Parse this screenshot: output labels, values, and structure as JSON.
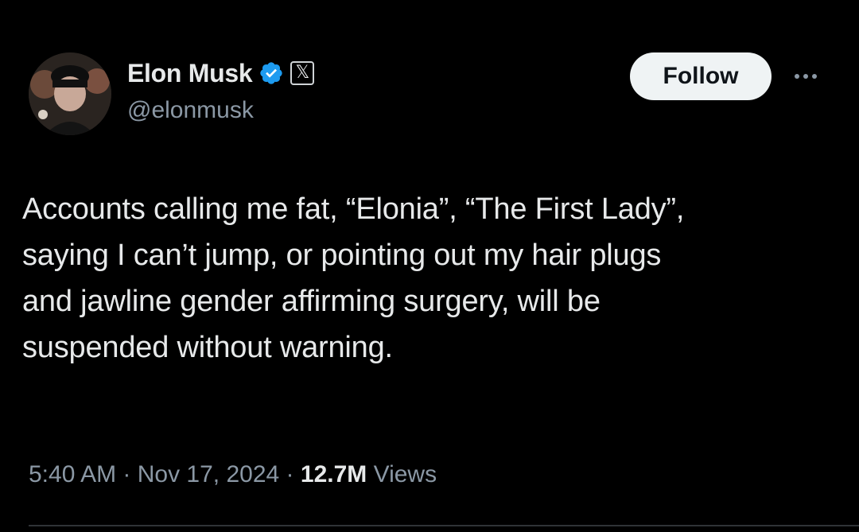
{
  "author": {
    "display_name": "Elon Musk",
    "handle": "@elonmusk",
    "verified_icon": "verified-badge-icon",
    "affiliate_icon": "x-logo-icon",
    "affiliate_glyph": "𝕏"
  },
  "actions": {
    "follow_label": "Follow",
    "more_icon": "more-options-icon"
  },
  "tweet": {
    "text": "Accounts calling me fat, “Elonia”, “The First Lady”,\nsaying I can’t jump, or pointing out my hair plugs\nand jawline gender affirming surgery, will be\nsuspended without warning."
  },
  "meta": {
    "time": "5:40 AM",
    "separator": " · ",
    "date": "Nov 17, 2024",
    "views_count": "12.7M",
    "views_label": " Views"
  },
  "colors": {
    "background": "#000000",
    "primary_text": "#e7e9ea",
    "secondary_text": "#8b98a5",
    "verified_blue": "#1d9bf0",
    "follow_bg": "#eff3f4"
  }
}
